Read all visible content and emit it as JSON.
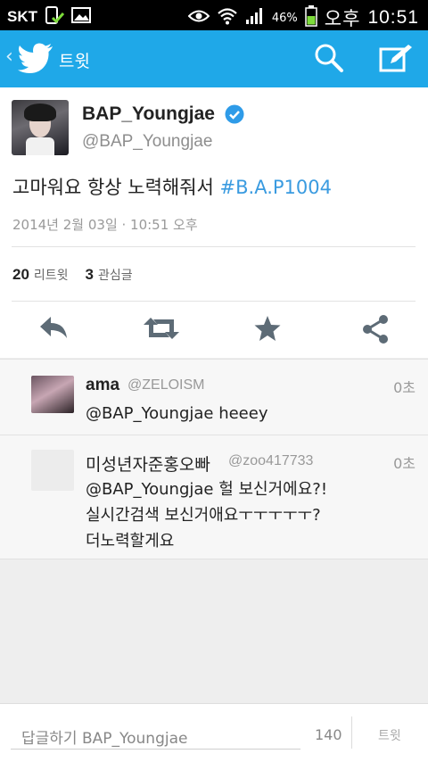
{
  "status_bar": {
    "carrier": "SKT",
    "battery_percent": "46%",
    "time_period": "오후",
    "time": "10:51",
    "icons": [
      "screenshot-icon",
      "gallery-icon",
      "eye-icon",
      "wifi-icon",
      "signal-icon",
      "battery-icon"
    ]
  },
  "action_bar": {
    "title": "트윗",
    "icons": [
      "back-chevron-icon",
      "twitter-bird-icon",
      "search-icon",
      "compose-icon"
    ],
    "color": "#1fa8e8"
  },
  "tweet": {
    "display_name": "BAP_Youngjae",
    "handle": "@BAP_Youngjae",
    "text_plain": "고마워요 항상 노력해줘서 ",
    "hashtag": "#B.A.P1004",
    "timestamp": "2014년 2월 03일 · 10:51 오후",
    "retweets_count": "20",
    "retweets_label": "리트윗",
    "favorites_count": "3",
    "favorites_label": "관심글",
    "actions": [
      "reply-icon",
      "retweet-icon",
      "favorite-star-icon",
      "share-icon"
    ]
  },
  "replies": [
    {
      "name": "ama",
      "handle": "@ZELOISM",
      "time": "0초",
      "text": "@BAP_Youngjae heeey"
    },
    {
      "name": "미성년자준홍오빠",
      "handle": "@zoo417733",
      "time": "0초",
      "lines": [
        "@BAP_Youngjae 헐 보신거에요?!",
        "실시간검색 보신거애요ㅜㅜㅜㅜㅜ?",
        "더노력할게요"
      ]
    }
  ],
  "compose": {
    "placeholder": "답글하기 BAP_Youngjae",
    "char_count": "140",
    "send_label": "트윗"
  }
}
